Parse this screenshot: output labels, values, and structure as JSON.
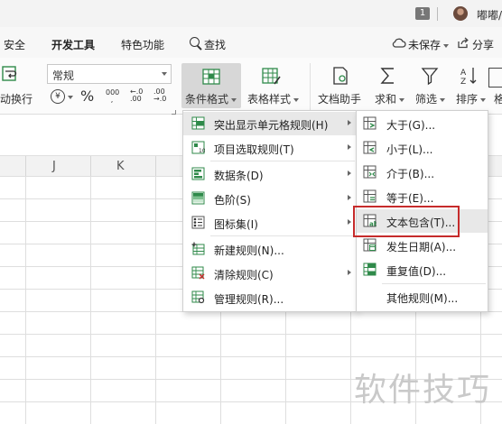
{
  "titlebar": {
    "page_badge": "1",
    "user_name": "嘟嘟/"
  },
  "tabs": [
    {
      "label": "安全"
    },
    {
      "label": "开发工具"
    },
    {
      "label": "特色功能"
    },
    {
      "label": "查找"
    }
  ],
  "tab_actions": {
    "unsaved": "未保存",
    "share": "分享"
  },
  "ribbon": {
    "wrap_text": "动换行",
    "font_value": "常规",
    "currency_symbol": "¥",
    "percent_symbol": "%",
    "thousands_symbol": "000",
    "inc_decimal": "←.0 .00",
    "dec_decimal": ".00 →.0",
    "conditional_format": "条件格式",
    "table_style": "表格样式",
    "doc_assistant": "文档助手",
    "sum": "求和",
    "filter": "筛选",
    "sort": "排序",
    "more": "格"
  },
  "columns": [
    "J",
    "K"
  ],
  "main_menu": {
    "items": [
      {
        "label": "突出显示单元格规则(H)",
        "icon": "highlight-rules-icon",
        "submenu": true,
        "active": true
      },
      {
        "label": "项目选取规则(T)",
        "icon": "top-bottom-rules-icon",
        "submenu": true
      },
      {
        "label": "数据条(D)",
        "icon": "data-bars-icon",
        "submenu": true
      },
      {
        "label": "色阶(S)",
        "icon": "color-scales-icon",
        "submenu": true
      },
      {
        "label": "图标集(I)",
        "icon": "icon-sets-icon",
        "submenu": true
      },
      {
        "label": "新建规则(N)...",
        "icon": "new-rule-icon",
        "submenu": false
      },
      {
        "label": "清除规则(C)",
        "icon": "clear-rules-icon",
        "submenu": true
      },
      {
        "label": "管理规则(R)...",
        "icon": "manage-rules-icon",
        "submenu": false
      }
    ]
  },
  "sub_menu": {
    "items": [
      {
        "label": "大于(G)...",
        "icon": "greater-than-icon"
      },
      {
        "label": "小于(L)...",
        "icon": "less-than-icon"
      },
      {
        "label": "介于(B)...",
        "icon": "between-icon"
      },
      {
        "label": "等于(E)...",
        "icon": "equal-to-icon"
      },
      {
        "label": "文本包含(T)...",
        "icon": "text-contains-icon",
        "highlighted": true
      },
      {
        "label": "发生日期(A)...",
        "icon": "date-occurring-icon"
      },
      {
        "label": "重复值(D)...",
        "icon": "duplicate-values-icon"
      },
      {
        "label": "其他规则(M)...",
        "icon": ""
      }
    ]
  },
  "watermark": "软件技巧",
  "colors": {
    "accent_green": "#2f8a4a",
    "highlight_red": "#c62b2b",
    "menu_hover": "#e8e8e8"
  }
}
